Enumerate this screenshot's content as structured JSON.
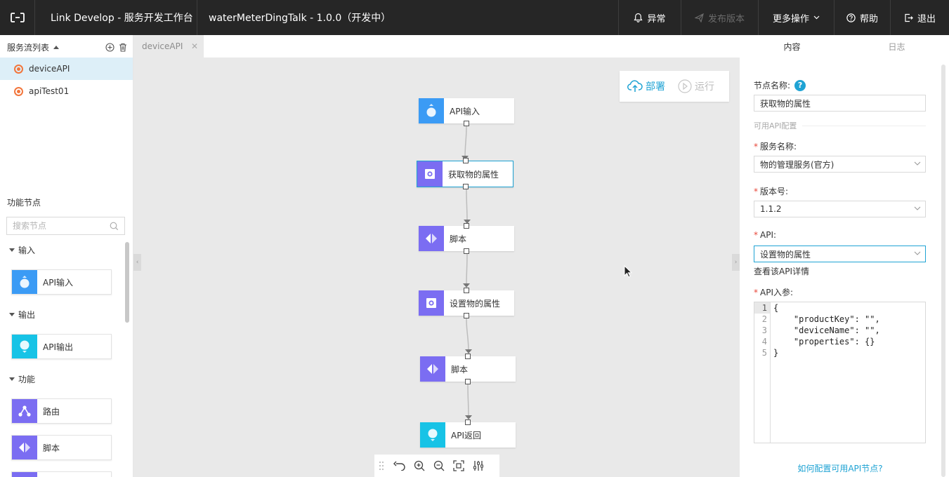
{
  "header": {
    "title": "Link Develop - 服务开发工作台",
    "project": "waterMeterDingTalk - 1.0.0（开发中）",
    "buttons": {
      "alert": "异常",
      "publish": "发布版本",
      "more": "更多操作",
      "help": "帮助",
      "logout": "退出"
    }
  },
  "left_panel": {
    "flows_title": "服务流列表",
    "flows": [
      {
        "label": "deviceAPI",
        "active": true
      },
      {
        "label": "apiTest01",
        "active": false
      }
    ],
    "nodes_title": "功能节点",
    "search_placeholder": "搜索节点",
    "categories": [
      {
        "label": "输入",
        "items": [
          {
            "label": "API输入",
            "icon": "api-input-icon",
            "color": "#3b9bf5"
          }
        ]
      },
      {
        "label": "输出",
        "items": [
          {
            "label": "API输出",
            "icon": "api-output-icon",
            "color": "#17c3e6"
          }
        ]
      },
      {
        "label": "功能",
        "items": [
          {
            "label": "路由",
            "icon": "route-icon",
            "color": "#7b6df2"
          },
          {
            "label": "脚本",
            "icon": "script-icon",
            "color": "#7b6df2"
          }
        ]
      }
    ]
  },
  "canvas": {
    "tab_label": "deviceAPI",
    "deploy_label": "部署",
    "run_label": "运行",
    "nodes": [
      {
        "label": "API输入",
        "icon": "api-input-icon",
        "color": "#3b9bf5"
      },
      {
        "label": "获取物的属性",
        "icon": "thing-property-icon",
        "color": "#7b6df2",
        "selected": true
      },
      {
        "label": "脚本",
        "icon": "script-icon",
        "color": "#7b6df2"
      },
      {
        "label": "设置物的属性",
        "icon": "thing-property-icon",
        "color": "#7b6df2"
      },
      {
        "label": "脚本",
        "icon": "script-icon",
        "color": "#7b6df2"
      },
      {
        "label": "API返回",
        "icon": "api-output-icon",
        "color": "#17c3e6"
      }
    ]
  },
  "right_panel": {
    "tabs": [
      "内容",
      "日志"
    ],
    "node_name_label": "节点名称:",
    "node_name_value": "获取物的属性",
    "section_label": "可用API配置",
    "service_label": "服务名称:",
    "service_value": "物的管理服务(官方)",
    "version_label": "版本号:",
    "version_value": "1.1.2",
    "api_label": "API:",
    "api_value": "设置物的属性",
    "api_detail_link": "查看该API详情",
    "params_label": "API入参:",
    "code_lines": [
      "{",
      "    \"productKey\": \"\",",
      "    \"deviceName\": \"\",",
      "    \"properties\": {}",
      "}"
    ],
    "line_numbers": [
      "1",
      "2",
      "3",
      "4",
      "5"
    ],
    "help_link": "如何配置可用API节点?"
  },
  "colors": {
    "accent": "#1fa3d4",
    "topbar": "#262626",
    "canvas_bg": "#e9e9e9",
    "required": "#e8483b",
    "flow_icon": "#f2763c"
  }
}
